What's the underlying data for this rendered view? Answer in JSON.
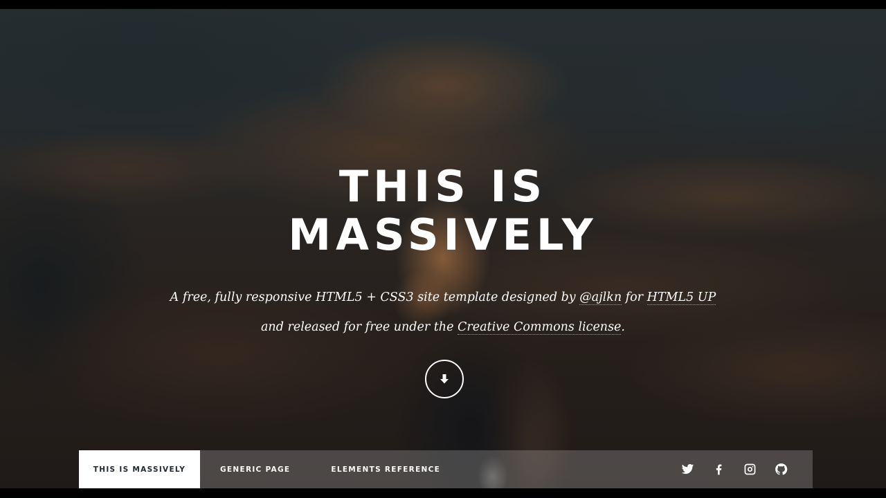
{
  "intro": {
    "title_line1": "This is",
    "title_line2": "Massively",
    "subtitle": {
      "line1_prefix": "A free, fully responsive HTML5 + CSS3 site template designed by ",
      "link_author": "@ajlkn",
      "line1_mid": " for ",
      "link_site": "HTML5 UP",
      "line2_prefix": "and released for free under the ",
      "link_license": "Creative Commons license",
      "line2_suffix": "."
    },
    "scroll_icon": "arrow-down-icon"
  },
  "nav": {
    "links": [
      {
        "label": "This is Massively",
        "active": true
      },
      {
        "label": "Generic Page",
        "active": false
      },
      {
        "label": "Elements Reference",
        "active": false
      }
    ],
    "icons": [
      "twitter-icon",
      "facebook-icon",
      "instagram-icon",
      "github-icon"
    ]
  },
  "colors": {
    "text": "#ffffff",
    "active_tab_bg": "#ffffff",
    "active_tab_text": "#212931",
    "nav_bg": "rgba(255,255,255,0.2)"
  }
}
